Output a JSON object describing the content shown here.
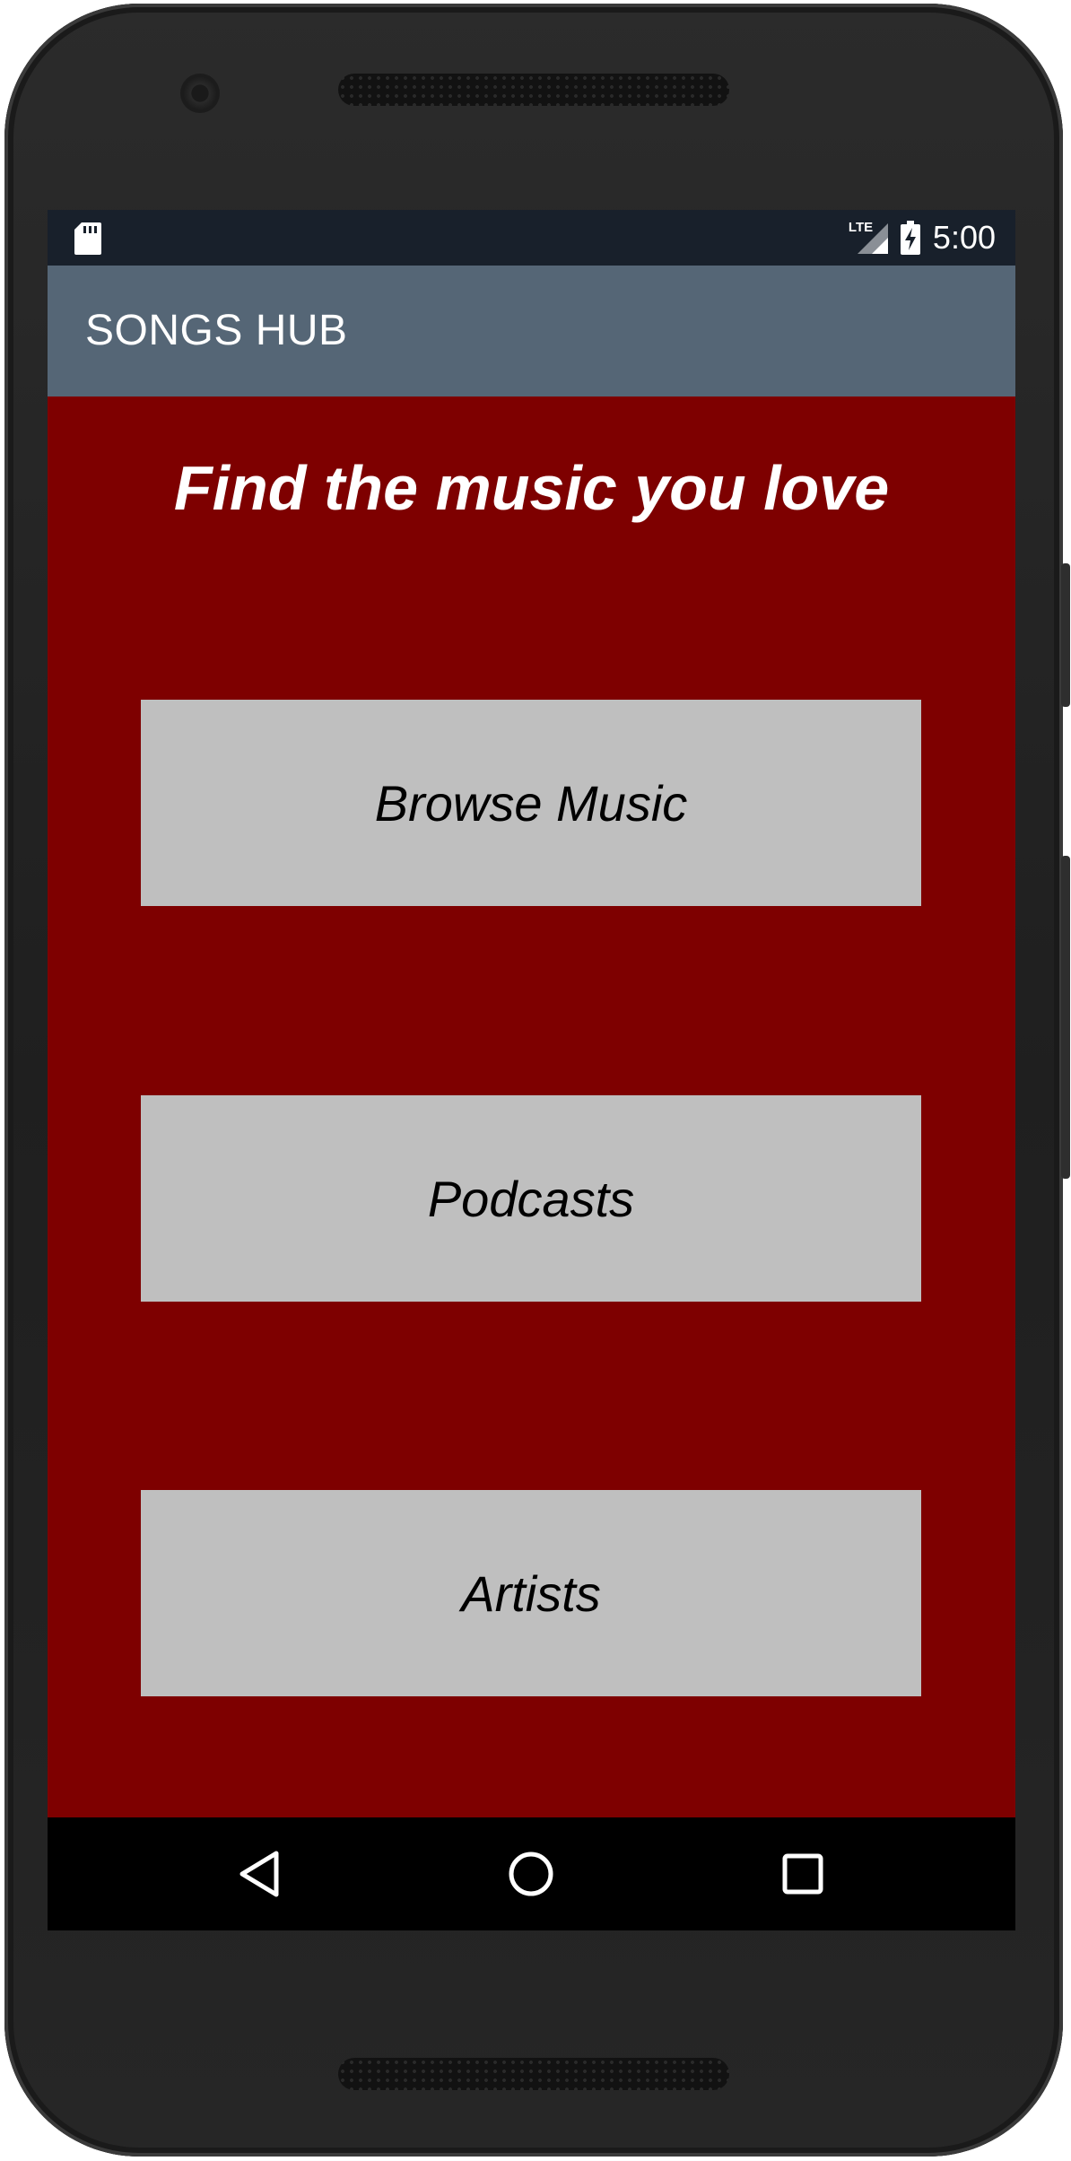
{
  "status_bar": {
    "time": "5:00",
    "network": "LTE",
    "icons": [
      "sd-card-icon",
      "lte-signal-icon",
      "battery-charging-icon"
    ]
  },
  "app_bar": {
    "title": "SONGS HUB"
  },
  "main": {
    "headline": "Find the music you love",
    "buttons": [
      {
        "label": "Browse Music"
      },
      {
        "label": "Podcasts"
      },
      {
        "label": "Artists"
      }
    ]
  },
  "nav_bar": {
    "icons": [
      "back-icon",
      "home-icon",
      "recents-icon"
    ]
  },
  "colors": {
    "background": "#7e0000",
    "app_bar": "#556676",
    "status_bar": "#18202b",
    "button": "#bfbfbf",
    "nav_bar": "#000000"
  }
}
